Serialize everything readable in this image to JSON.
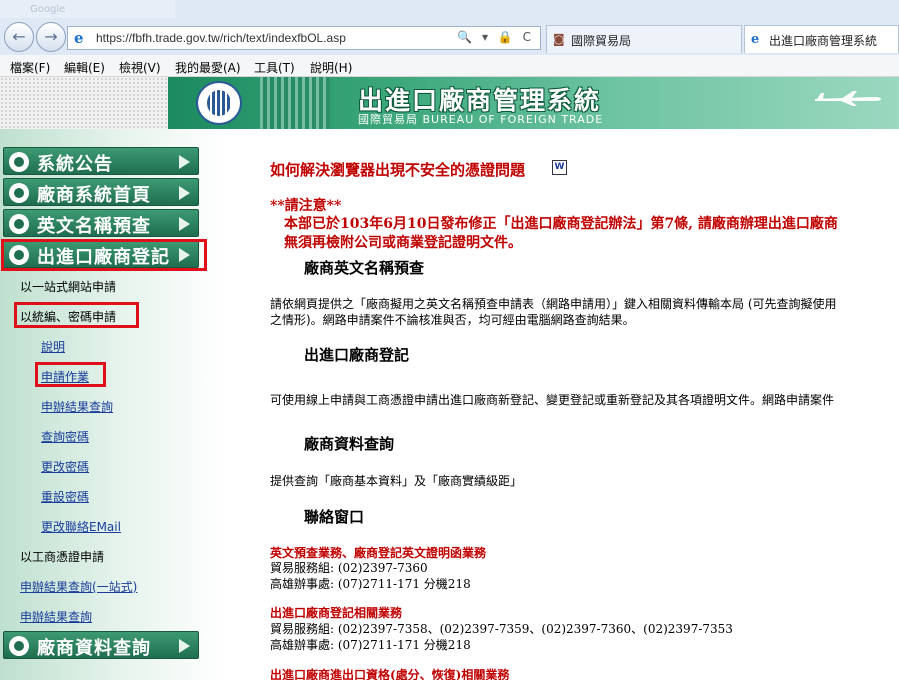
{
  "browser": {
    "ghost_tab": "Google",
    "back_glyph": "←",
    "forward_glyph": "→",
    "url": "https://fbfh.trade.gov.tw/rich/text/indexfbOL.asp",
    "address_tools": "🔍 ▾ 🔒 C",
    "tabs": [
      {
        "label": "國際貿易局",
        "icon": "globe-icon"
      },
      {
        "label": "出進口廠商管理系統",
        "icon": "ie-icon"
      }
    ],
    "menu": [
      "檔案(F)",
      "編輯(E)",
      "檢視(V)",
      "我的最愛(A)",
      "工具(T)",
      "說明(H)"
    ]
  },
  "banner": {
    "title": "出進口廠商管理系統",
    "subtitle": "國際貿易局  BUREAU OF FOREIGN TRADE"
  },
  "sidebar": {
    "nav": [
      "系統公告",
      "廠商系統首頁",
      "英文名稱預查",
      "出進口廠商登記",
      "廠商資料查詢"
    ],
    "links": {
      "one_stop": "以一站式網站申請",
      "tax_id_password": "以統編、密碼申請",
      "explain": "說明",
      "apply": "申請作業",
      "result_query": "申辦結果查詢",
      "query_password": "查詢密碼",
      "change_password": "更改密碼",
      "reset_password": "重設密碼",
      "change_email": "更改聯絡EMail",
      "biz_cert_apply": "以工商憑證申請",
      "result_query_one_stop": "申辦結果查詢(一站式)",
      "result_query_2": "申辦結果查詢"
    }
  },
  "main": {
    "headline": "如何解決瀏覽器出現不安全的憑證問題",
    "doc_icon_text": "W",
    "notice_title": "**請注意**",
    "notice_line1": "本部已於103年6月10日發布修正「出進口廠商登記辦法」第7條, 請廠商辦理出進口廠商",
    "notice_line2": "無須再檢附公司或商業登記證明文件。",
    "sec1_title": "廠商英文名稱預查",
    "sec1_line1": "請依網頁提供之「廠商擬用之英文名稱預查申請表（網路申請用）」鍵入相關資料傳輸本局 (可先查詢擬使用",
    "sec1_line2": "之情形)。網路申請案件不論核准與否，均可經由電腦網路查詢結果。",
    "sec2_title": "出進口廠商登記",
    "sec2_line1": "可使用線上申請與工商憑證申請出進口廠商新登記、變更登記或重新登記及其各項證明文件。網路申請案件",
    "sec3_title": "廠商資料查詢",
    "sec3_line1": "提供查詢「廠商基本資料」及「廠商實績級距」",
    "contact_title": "聯絡窗口",
    "c1_heading": "英文預查業務、廠商登記英文證明函業務",
    "c1_line1": "貿易服務組:   (02)2397-7360",
    "c1_line2": "高雄辦事處:   (07)2711-171 分機218",
    "c2_heading": "出進口廠商登記相關業務",
    "c2_line1": "貿易服務組:   (02)2397-7358、(02)2397-7359、(02)2397-7360、(02)2397-7353",
    "c2_line2": "高雄辦事處:   (07)2711-171 分機218",
    "c3_heading": "出進口廠商進出口資格(處分、恢復)相關業務"
  }
}
